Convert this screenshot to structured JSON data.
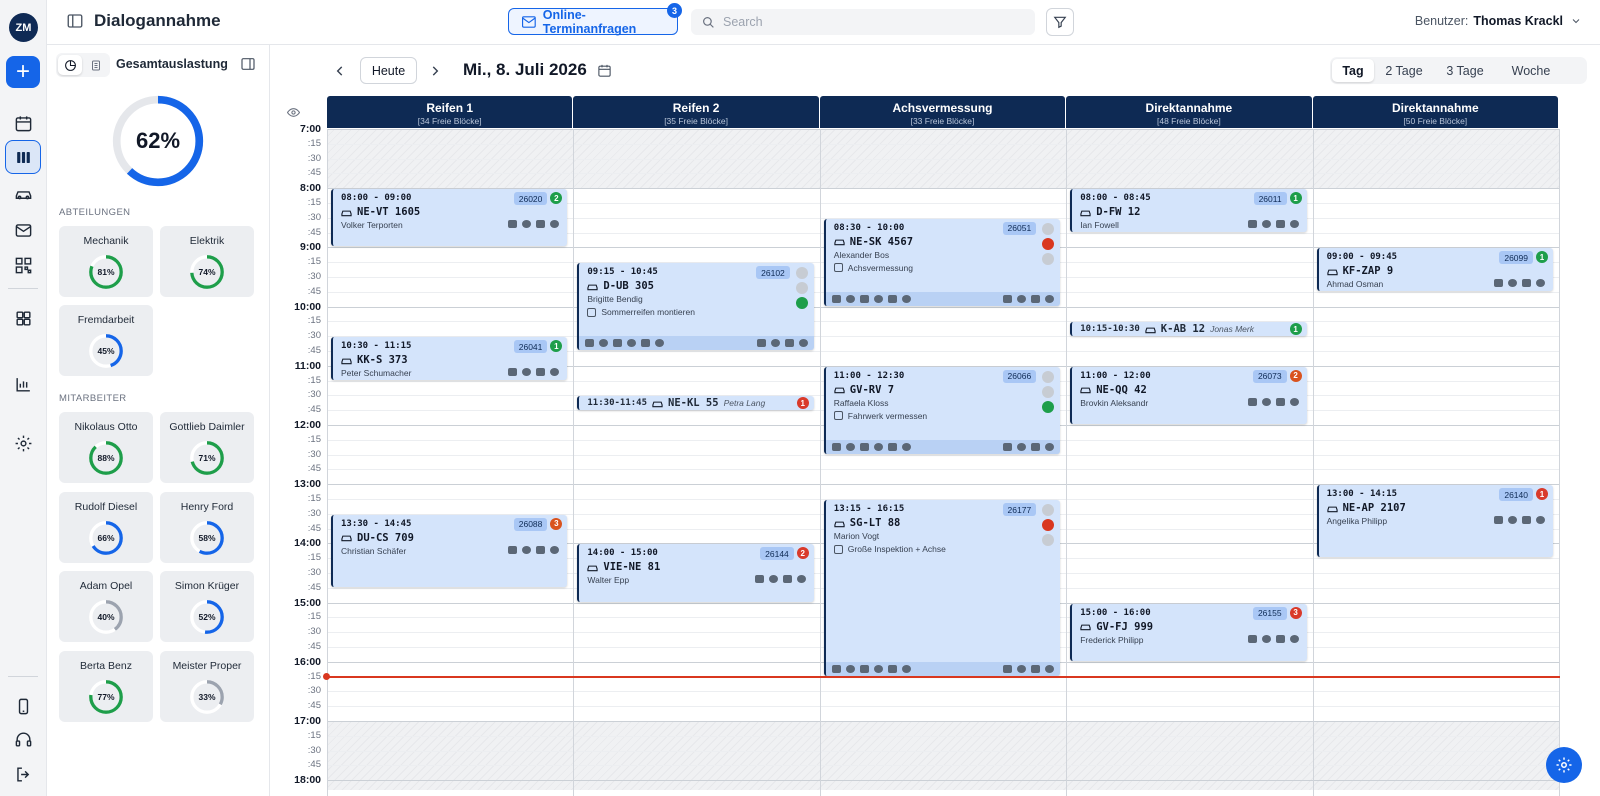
{
  "app": {
    "avatar": "ZM",
    "add": "+",
    "page_title": "Dialogannahme"
  },
  "rail": {
    "items": [
      "calendar-icon",
      "columns-icon",
      "car-icon",
      "mail-icon",
      "qr-icon",
      "grid-icon",
      "chart-icon",
      "gear-icon",
      "phone-icon",
      "headset-icon",
      "logout-icon"
    ],
    "active": "columns-icon"
  },
  "header": {
    "online_label": "Online-Terminanfragen",
    "online_badge": "3",
    "search_placeholder": "Search",
    "user_label": "Benutzer:",
    "user_name": "Thomas Krackl"
  },
  "sidebar": {
    "title": "Gesamtauslastung",
    "total": {
      "label": "62%",
      "value": 62
    },
    "departments_label": "ABTEILUNGEN",
    "departments": [
      {
        "name": "Mechanik",
        "label": "81%",
        "value": 81,
        "color": "#1e9e4a"
      },
      {
        "name": "Elektrik",
        "label": "74%",
        "value": 74,
        "color": "#1e9e4a"
      },
      {
        "name": "Fremdarbeit",
        "label": "45%",
        "value": 45,
        "color": "#1565e8"
      }
    ],
    "employees_label": "MITARBEITER",
    "employees": [
      {
        "name": "Nikolaus Otto",
        "label": "88%",
        "value": 88,
        "color": "#1e9e4a"
      },
      {
        "name": "Gottlieb Daimler",
        "label": "71%",
        "value": 71,
        "color": "#1e9e4a"
      },
      {
        "name": "Rudolf Diesel",
        "label": "66%",
        "value": 66,
        "color": "#1565e8"
      },
      {
        "name": "Henry Ford",
        "label": "58%",
        "value": 58,
        "color": "#1565e8"
      },
      {
        "name": "Adam Opel",
        "label": "40%",
        "value": 40,
        "color": "#9ca3af"
      },
      {
        "name": "Simon Krüger",
        "label": "52%",
        "value": 52,
        "color": "#1565e8"
      },
      {
        "name": "Berta Benz",
        "label": "77%",
        "value": 77,
        "color": "#1e9e4a"
      },
      {
        "name": "Meister Proper",
        "label": "33%",
        "value": 33,
        "color": "#9ca3af"
      }
    ]
  },
  "calendar": {
    "today": "Heute",
    "date": "Mi., 8. Juli 2026",
    "views": [
      "Tag",
      "2 Tage",
      "3 Tage",
      "Woche"
    ],
    "active_view": "Tag",
    "columns": [
      {
        "name": "Reifen 1",
        "blocks": "[34 Freie Blöcke]"
      },
      {
        "name": "Reifen 2",
        "blocks": "[35 Freie Blöcke]"
      },
      {
        "name": "Achsvermessung",
        "blocks": "[33 Freie Blöcke]"
      },
      {
        "name": "Direktannahme",
        "blocks": "[48 Freie Blöcke]"
      },
      {
        "name": "Direktannahme",
        "blocks": "[50 Freie Blöcke]"
      }
    ],
    "time_labels": [
      "7:00",
      ":15",
      ":30",
      ":45",
      "8:00",
      ":15",
      ":30",
      ":45",
      "9:00",
      ":15",
      ":30",
      ":45",
      "10:00",
      ":15",
      ":30",
      ":45",
      "11:00",
      ":15",
      ":30",
      ":45",
      "12:00",
      ":15",
      ":30",
      ":45",
      "13:00",
      ":15",
      ":30",
      ":45",
      "14:00",
      ":15",
      ":30",
      ":45",
      "15:00",
      ":15",
      ":30",
      ":45",
      "16:00",
      ":15",
      ":30",
      ":45",
      "17:00",
      ":15",
      ":30",
      ":45",
      "18:00"
    ],
    "now": "16:15",
    "events": [
      {
        "col": 0,
        "start": "08:00",
        "end": "09:00",
        "time": "08:00 - 09:00",
        "plate": "NE-VT 1605",
        "name": "Volker Terporten",
        "num": "26020",
        "count": "2",
        "count_color": "green"
      },
      {
        "col": 0,
        "start": "10:30",
        "end": "11:15",
        "time": "10:30 - 11:15",
        "plate": "KK-S 373",
        "name": "Peter Schumacher",
        "num": "26041",
        "count": "1",
        "count_color": "green"
      },
      {
        "col": 0,
        "start": "13:30",
        "end": "14:45",
        "time": "13:30 - 14:45",
        "plate": "DU-CS 709",
        "name": "Christian Schäfer",
        "num": "26088",
        "count": "3",
        "count_color": "orange"
      },
      {
        "col": 1,
        "start": "09:15",
        "end": "10:45",
        "time": "09:15 - 10:45",
        "plate": "D-UB 305",
        "name": "Brigitte Bendig",
        "num": "26102",
        "task": "Sommerreifen montieren",
        "light": "green",
        "toolbar": true
      },
      {
        "col": 1,
        "start": "14:00",
        "end": "15:00",
        "time": "14:00 - 15:00",
        "plate": "VIE-NE 81",
        "name": "Walter Epp",
        "num": "26144",
        "count": "2",
        "count_color": "red"
      },
      {
        "col": 2,
        "start": "08:30",
        "end": "10:00",
        "time": "08:30 - 10:00",
        "plate": "NE-SK 4567",
        "name": "Alexander Bos",
        "num": "26051",
        "task": "Achsvermessung",
        "light": "red",
        "toolbar": true
      },
      {
        "col": 2,
        "start": "11:00",
        "end": "12:30",
        "time": "11:00 - 12:30",
        "plate": "GV-RV 7",
        "name": "Raffaela Kloss",
        "num": "26066",
        "task": "Fahrwerk vermessen",
        "light": "green",
        "toolbar": true
      },
      {
        "col": 2,
        "start": "13:15",
        "end": "16:15",
        "time": "13:15 - 16:15",
        "plate": "SG-LT 88",
        "name": "Marion Vogt",
        "num": "26177",
        "task": "Große Inspektion + Achse",
        "light": "red",
        "toolbar": true
      },
      {
        "col": 3,
        "start": "08:00",
        "end": "08:45",
        "time": "08:00 - 08:45",
        "plate": "D-FW 12",
        "name": "Ian Fowell",
        "num": "26011",
        "count": "1",
        "count_color": "green"
      },
      {
        "col": 3,
        "start": "11:00",
        "end": "12:00",
        "time": "11:00 - 12:00",
        "plate": "NE-QQ 42",
        "name": "Brovkin Aleksandr",
        "num": "26073",
        "count": "2",
        "count_color": "orange"
      },
      {
        "col": 3,
        "start": "15:00",
        "end": "16:00",
        "time": "15:00 - 16:00",
        "plate": "GV-FJ 999",
        "name": "Frederick Philipp",
        "num": "26155",
        "count": "3",
        "count_color": "red"
      },
      {
        "col": 4,
        "start": "09:00",
        "end": "09:45",
        "time": "09:00 - 09:45",
        "plate": "KF-ZAP 9",
        "name": "Ahmad Osman",
        "num": "26099",
        "count": "1",
        "count_color": "green"
      },
      {
        "col": 4,
        "start": "13:00",
        "end": "14:15",
        "time": "13:00 - 14:15",
        "plate": "NE-AP 2107",
        "name": "Angelika Philipp",
        "num": "26140",
        "count": "1",
        "count_color": "red"
      }
    ],
    "slim_events": [
      {
        "col": 1,
        "start": "11:30",
        "time": "11:30-11:45",
        "plate": "NE-KL 55",
        "name": "Petra Lang",
        "count": "1",
        "count_color": "red"
      },
      {
        "col": 3,
        "start": "10:15",
        "time": "10:15-10:30",
        "plate": "K-AB 12",
        "name": "Jonas Merk",
        "count": "1",
        "count_color": "green"
      }
    ]
  }
}
